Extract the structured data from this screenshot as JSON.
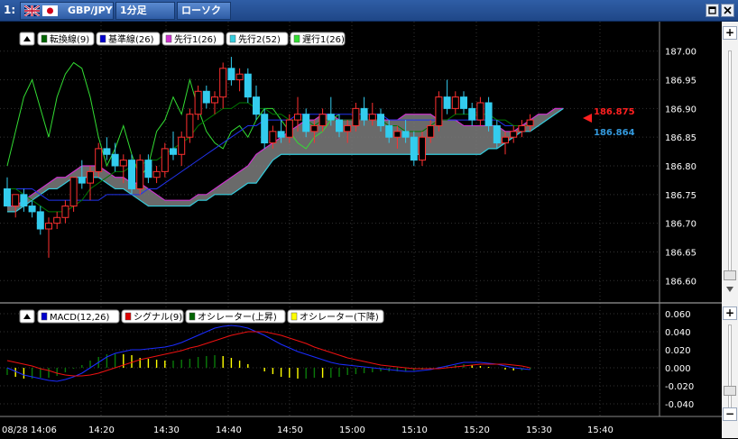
{
  "window": {
    "number": "1:",
    "pair": "GBP/JPY",
    "timeframe": "1分足",
    "chart_style": "ローソク"
  },
  "main_legend": [
    {
      "label": "転換線(9)",
      "color": "#006400"
    },
    {
      "label": "基準線(26)",
      "color": "#0000cd"
    },
    {
      "label": "先行1(26)",
      "color": "#cc33cc"
    },
    {
      "label": "先行2(52)",
      "color": "#33ccdd"
    },
    {
      "label": "遅行1(26)",
      "color": "#33dd33"
    }
  ],
  "macd_legend": [
    {
      "label": "MACD(12,26)",
      "color": "#0000cd"
    },
    {
      "label": "シグナル(9)",
      "color": "#dd0000"
    },
    {
      "label": "オシレーター(上昇)",
      "color": "#006400"
    },
    {
      "label": "オシレーター(下降)",
      "color": "#ffff00"
    }
  ],
  "price_labels": {
    "ask": "186.875",
    "bid": "186.864",
    "ask_color": "#ff2020",
    "bid_color": "#3399dd"
  },
  "chart_data": {
    "type": "candlestick",
    "instrument": "GBP/JPY",
    "price_axis": {
      "ticks": [
        "187.00",
        "186.95",
        "186.90",
        "186.85",
        "186.80",
        "186.75",
        "186.70",
        "186.65",
        "186.60"
      ],
      "range": [
        186.58,
        187.02
      ]
    },
    "macd_axis": {
      "ticks": [
        "0.060",
        "0.040",
        "0.020",
        "0.000",
        "-0.020",
        "-0.040"
      ],
      "range": [
        -0.05,
        0.066
      ]
    },
    "time_axis": [
      "08/28 14:06",
      "14:20",
      "14:30",
      "14:40",
      "14:50",
      "15:00",
      "15:10",
      "15:20",
      "15:30",
      "15:40"
    ],
    "candles": [
      [
        186.76,
        186.78,
        186.73,
        186.73
      ],
      [
        186.73,
        186.75,
        186.71,
        186.75
      ],
      [
        186.75,
        186.76,
        186.72,
        186.73
      ],
      [
        186.73,
        186.74,
        186.71,
        186.72
      ],
      [
        186.72,
        186.73,
        186.68,
        186.69
      ],
      [
        186.69,
        186.71,
        186.64,
        186.7
      ],
      [
        186.7,
        186.72,
        186.69,
        186.71
      ],
      [
        186.71,
        186.74,
        186.7,
        186.73
      ],
      [
        186.73,
        186.78,
        186.72,
        186.78
      ],
      [
        186.78,
        186.81,
        186.76,
        186.77
      ],
      [
        186.77,
        186.8,
        186.74,
        186.79
      ],
      [
        186.79,
        186.84,
        186.78,
        186.83
      ],
      [
        186.83,
        186.85,
        186.81,
        186.82
      ],
      [
        186.82,
        186.84,
        186.79,
        186.8
      ],
      [
        186.8,
        186.82,
        186.77,
        186.81
      ],
      [
        186.81,
        186.82,
        186.75,
        186.76
      ],
      [
        186.76,
        186.82,
        186.75,
        186.81
      ],
      [
        186.81,
        186.82,
        186.77,
        186.78
      ],
      [
        186.78,
        186.8,
        186.77,
        186.79
      ],
      [
        186.79,
        186.84,
        186.78,
        186.83
      ],
      [
        186.83,
        186.86,
        186.81,
        186.82
      ],
      [
        186.82,
        186.86,
        186.8,
        186.85
      ],
      [
        186.85,
        186.9,
        186.84,
        186.89
      ],
      [
        186.89,
        186.94,
        186.88,
        186.93
      ],
      [
        186.93,
        186.94,
        186.9,
        186.91
      ],
      [
        186.91,
        186.93,
        186.89,
        186.92
      ],
      [
        186.92,
        186.98,
        186.9,
        186.97
      ],
      [
        186.97,
        186.99,
        186.94,
        186.95
      ],
      [
        186.95,
        186.97,
        186.93,
        186.96
      ],
      [
        186.96,
        186.97,
        186.91,
        186.92
      ],
      [
        186.92,
        186.94,
        186.88,
        186.89
      ],
      [
        186.89,
        186.9,
        186.83,
        186.84
      ],
      [
        186.84,
        186.87,
        186.83,
        186.86
      ],
      [
        186.86,
        186.88,
        186.84,
        186.85
      ],
      [
        186.85,
        186.89,
        186.84,
        186.88
      ],
      [
        186.88,
        186.92,
        186.86,
        186.89
      ],
      [
        186.89,
        186.9,
        186.85,
        186.86
      ],
      [
        186.86,
        186.88,
        186.84,
        186.87
      ],
      [
        186.87,
        186.9,
        186.86,
        186.89
      ],
      [
        186.89,
        186.92,
        186.87,
        186.88
      ],
      [
        186.88,
        186.89,
        186.85,
        186.86
      ],
      [
        186.86,
        186.88,
        186.84,
        186.87
      ],
      [
        186.87,
        186.91,
        186.86,
        186.9
      ],
      [
        186.9,
        186.92,
        186.87,
        186.88
      ],
      [
        186.88,
        186.91,
        186.87,
        186.89
      ],
      [
        186.89,
        186.9,
        186.86,
        186.87
      ],
      [
        186.87,
        186.88,
        186.84,
        186.85
      ],
      [
        186.85,
        186.87,
        186.83,
        186.86
      ],
      [
        186.86,
        186.88,
        186.84,
        186.85
      ],
      [
        186.85,
        186.86,
        186.8,
        186.81
      ],
      [
        186.81,
        186.86,
        186.8,
        186.85
      ],
      [
        186.85,
        186.88,
        186.84,
        186.87
      ],
      [
        186.87,
        186.93,
        186.86,
        186.92
      ],
      [
        186.92,
        186.95,
        186.89,
        186.9
      ],
      [
        186.9,
        186.93,
        186.89,
        186.92
      ],
      [
        186.92,
        186.93,
        186.89,
        186.9
      ],
      [
        186.9,
        186.91,
        186.87,
        186.88
      ],
      [
        186.88,
        186.92,
        186.87,
        186.91
      ],
      [
        186.91,
        186.92,
        186.86,
        186.87
      ],
      [
        186.87,
        186.88,
        186.83,
        186.84
      ],
      [
        186.84,
        186.86,
        186.82,
        186.85
      ],
      [
        186.85,
        186.87,
        186.84,
        186.86
      ],
      [
        186.86,
        186.88,
        186.85,
        186.87
      ],
      [
        186.87,
        186.89,
        186.86,
        186.88
      ]
    ],
    "ichimoku": {
      "tenkan_9": [
        186.76,
        186.76,
        186.75,
        186.74,
        186.73,
        186.72,
        186.72,
        186.72,
        186.73,
        186.74,
        186.76,
        186.77,
        186.78,
        186.79,
        186.79,
        186.8,
        186.8,
        186.81,
        186.81,
        186.82,
        186.83,
        186.84,
        186.85,
        186.87,
        186.88,
        186.89,
        186.9,
        186.9,
        186.91,
        186.91,
        186.9,
        186.9,
        186.89,
        186.89,
        186.88,
        186.88,
        186.88,
        186.87,
        186.88,
        186.88,
        186.88,
        186.88,
        186.88,
        186.88,
        186.88,
        186.88,
        186.87,
        186.87,
        186.86,
        186.86,
        186.86,
        186.87,
        186.88,
        186.88,
        186.89,
        186.89,
        186.89,
        186.89,
        186.89,
        186.88,
        186.88,
        186.87,
        186.87,
        186.87
      ],
      "kijun_26": [
        186.76,
        186.76,
        186.76,
        186.76,
        186.75,
        186.74,
        186.74,
        186.74,
        186.74,
        186.74,
        186.74,
        186.74,
        186.75,
        186.75,
        186.75,
        186.75,
        186.75,
        186.76,
        186.76,
        186.77,
        186.78,
        186.79,
        186.8,
        186.81,
        186.82,
        186.83,
        186.84,
        186.85,
        186.86,
        186.87,
        186.87,
        186.88,
        186.88,
        186.88,
        186.88,
        186.89,
        186.89,
        186.89,
        186.89,
        186.89,
        186.89,
        186.89,
        186.89,
        186.89,
        186.89,
        186.89,
        186.88,
        186.88,
        186.88,
        186.88,
        186.88,
        186.88,
        186.88,
        186.88,
        186.88,
        186.88,
        186.88,
        186.88,
        186.88,
        186.88,
        186.87,
        186.87,
        186.87,
        186.87
      ],
      "senkou_a_26": [
        186.73,
        186.73,
        186.74,
        186.75,
        186.76,
        186.77,
        186.78,
        186.78,
        186.79,
        186.8,
        186.8,
        186.8,
        186.79,
        186.78,
        186.78,
        186.77,
        186.77,
        186.76,
        186.75,
        186.74,
        186.74,
        186.74,
        186.74,
        186.75,
        186.75,
        186.76,
        186.77,
        186.78,
        186.79,
        186.8,
        186.82,
        186.83,
        186.84,
        186.85,
        186.86,
        186.87,
        186.88,
        186.88,
        186.89,
        186.89,
        186.88,
        186.88,
        186.88,
        186.88,
        186.88,
        186.88,
        186.88,
        186.88,
        186.89,
        186.89,
        186.89,
        186.89,
        186.88,
        186.88,
        186.88,
        186.87,
        186.87,
        186.87,
        186.87,
        186.87,
        186.86,
        186.86,
        186.87,
        186.88,
        186.89,
        186.89,
        186.9,
        186.9
      ],
      "senkou_b_52": [
        186.72,
        186.72,
        186.73,
        186.74,
        186.75,
        186.76,
        186.76,
        186.77,
        186.78,
        186.78,
        186.78,
        186.78,
        186.77,
        186.76,
        186.76,
        186.75,
        186.74,
        186.73,
        186.73,
        186.73,
        186.73,
        186.73,
        186.73,
        186.74,
        186.74,
        186.75,
        186.75,
        186.75,
        186.76,
        186.77,
        186.77,
        186.79,
        186.81,
        186.82,
        186.82,
        186.82,
        186.82,
        186.82,
        186.82,
        186.82,
        186.82,
        186.82,
        186.82,
        186.82,
        186.82,
        186.82,
        186.82,
        186.82,
        186.82,
        186.82,
        186.82,
        186.82,
        186.82,
        186.82,
        186.82,
        186.82,
        186.82,
        186.82,
        186.83,
        186.83,
        186.84,
        186.85,
        186.86,
        186.86,
        186.87,
        186.88,
        186.89,
        186.9
      ],
      "chikou_26": [
        186.8,
        186.86,
        186.92,
        186.95,
        186.9,
        186.85,
        186.92,
        186.96,
        186.98,
        186.97,
        186.92,
        186.85,
        186.8,
        186.83,
        186.87,
        186.82,
        186.78,
        186.8,
        186.86,
        186.88,
        186.92,
        186.89,
        186.95,
        186.9,
        186.86,
        186.84,
        186.83,
        186.86,
        186.87,
        186.85,
        186.88,
        186.9,
        186.9,
        186.88,
        186.86,
        186.84,
        186.83,
        186.85,
        186.86,
        186.88,
        186.89
      ]
    },
    "macd": {
      "macd_12_26": [
        0.0,
        -0.004,
        -0.008,
        -0.01,
        -0.012,
        -0.014,
        -0.015,
        -0.013,
        -0.01,
        -0.006,
        0.0,
        0.006,
        0.012,
        0.016,
        0.018,
        0.02,
        0.02,
        0.021,
        0.022,
        0.023,
        0.025,
        0.028,
        0.032,
        0.036,
        0.04,
        0.044,
        0.046,
        0.047,
        0.046,
        0.044,
        0.04,
        0.036,
        0.031,
        0.026,
        0.022,
        0.018,
        0.015,
        0.012,
        0.009,
        0.006,
        0.004,
        0.003,
        0.002,
        0.001,
        0.0,
        -0.001,
        -0.002,
        -0.003,
        -0.004,
        -0.004,
        -0.003,
        -0.002,
        0.0,
        0.002,
        0.004,
        0.006,
        0.006,
        0.006,
        0.005,
        0.004,
        0.002,
        0.0,
        -0.001,
        -0.002
      ],
      "signal_9": [
        0.008,
        0.006,
        0.004,
        0.002,
        -0.001,
        -0.003,
        -0.006,
        -0.008,
        -0.009,
        -0.009,
        -0.008,
        -0.006,
        -0.003,
        0.0,
        0.003,
        0.006,
        0.009,
        0.011,
        0.013,
        0.015,
        0.017,
        0.019,
        0.022,
        0.024,
        0.027,
        0.03,
        0.033,
        0.036,
        0.038,
        0.04,
        0.04,
        0.04,
        0.038,
        0.036,
        0.033,
        0.03,
        0.027,
        0.023,
        0.02,
        0.017,
        0.014,
        0.011,
        0.009,
        0.007,
        0.005,
        0.003,
        0.002,
        0.001,
        0.0,
        -0.001,
        -0.001,
        -0.001,
        -0.001,
        0.0,
        0.001,
        0.002,
        0.003,
        0.004,
        0.004,
        0.004,
        0.004,
        0.003,
        0.002,
        0.0
      ]
    }
  }
}
